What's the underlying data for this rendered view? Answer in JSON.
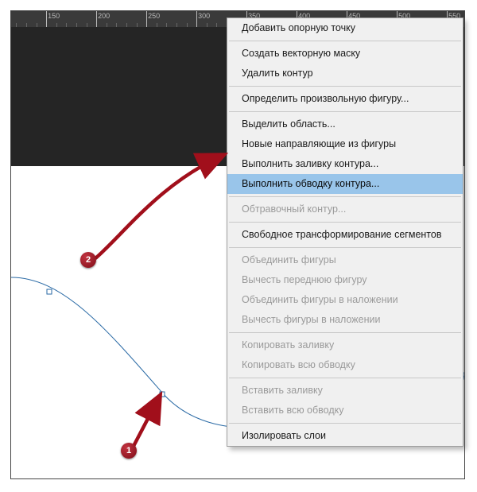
{
  "ruler": {
    "labels": [
      "150",
      "200",
      "250",
      "300"
    ]
  },
  "menu": {
    "groups": [
      [
        {
          "key": "add_anchor",
          "label": "Добавить опорную точку",
          "enabled": true
        }
      ],
      [
        {
          "key": "create_vector_mask",
          "label": "Создать векторную маску",
          "enabled": true
        },
        {
          "key": "delete_path",
          "label": "Удалить контур",
          "enabled": true
        }
      ],
      [
        {
          "key": "define_custom_shape",
          "label": "Определить произвольную фигуру...",
          "enabled": true
        }
      ],
      [
        {
          "key": "make_selection",
          "label": "Выделить область...",
          "enabled": true
        },
        {
          "key": "new_guides_from_shape",
          "label": "Новые направляющие из фигуры",
          "enabled": true
        },
        {
          "key": "fill_path",
          "label": "Выполнить заливку контура...",
          "enabled": true
        },
        {
          "key": "stroke_path",
          "label": "Выполнить обводку контура...",
          "enabled": true,
          "highlight": true
        }
      ],
      [
        {
          "key": "clipping_path",
          "label": "Обтравочный контур...",
          "enabled": false
        }
      ],
      [
        {
          "key": "free_transform_points",
          "label": "Свободное трансформирование сегментов",
          "enabled": true
        }
      ],
      [
        {
          "key": "unite_shapes",
          "label": "Объединить фигуры",
          "enabled": false
        },
        {
          "key": "subtract_front_shape",
          "label": "Вычесть переднюю фигуру",
          "enabled": false
        },
        {
          "key": "unite_at_overlap",
          "label": "Объединить фигуры в наложении",
          "enabled": false
        },
        {
          "key": "subtract_at_overlap",
          "label": "Вычесть фигуры в наложении",
          "enabled": false
        }
      ],
      [
        {
          "key": "copy_fill",
          "label": "Копировать заливку",
          "enabled": false
        },
        {
          "key": "copy_all_stroke",
          "label": "Копировать всю обводку",
          "enabled": false
        }
      ],
      [
        {
          "key": "paste_fill",
          "label": "Вставить заливку",
          "enabled": false
        },
        {
          "key": "paste_all_stroke",
          "label": "Вставить всю обводку",
          "enabled": false
        }
      ],
      [
        {
          "key": "isolate_layers",
          "label": "Изолировать слои",
          "enabled": true
        }
      ]
    ]
  },
  "callouts": {
    "c1": "1",
    "c2": "2"
  }
}
